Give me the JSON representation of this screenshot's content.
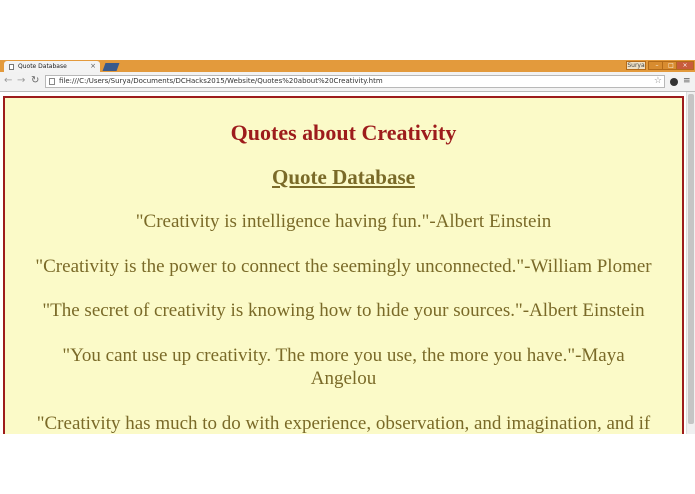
{
  "browser": {
    "tab_title": "Quote Database",
    "tab_close": "×",
    "user_label": "Surya",
    "window_controls": {
      "minimize": "–",
      "maximize": "□",
      "close": "×"
    },
    "nav": {
      "back": "←",
      "forward": "→",
      "reload": "↻"
    },
    "url": "file:///C:/Users/Surya/Documents/DCHacks2015/Website/Quotes%20about%20Creativity.htm",
    "bookmark_icon": "☆",
    "menu_icon": "≡"
  },
  "page": {
    "heading": "Quotes about Creativity",
    "link": "Quote Database",
    "quotes": [
      "\"Creativity is intelligence having fun.\"-Albert Einstein",
      "\"Creativity is the power to connect the seemingly unconnected.\"-William Plomer",
      "\"The secret of creativity is knowing how to hide your sources.\"-Albert Einstein",
      "\"You cant use up creativity. The more you use, the more you have.\"-Maya Angelou",
      "\"Creativity has much to do with experience, observation, and imagination, and if"
    ]
  },
  "colors": {
    "page_background": "#fbfac8",
    "border_and_heading": "#9d1c1c",
    "body_text": "#7a6a28",
    "titlebar": "#e39a3c"
  }
}
